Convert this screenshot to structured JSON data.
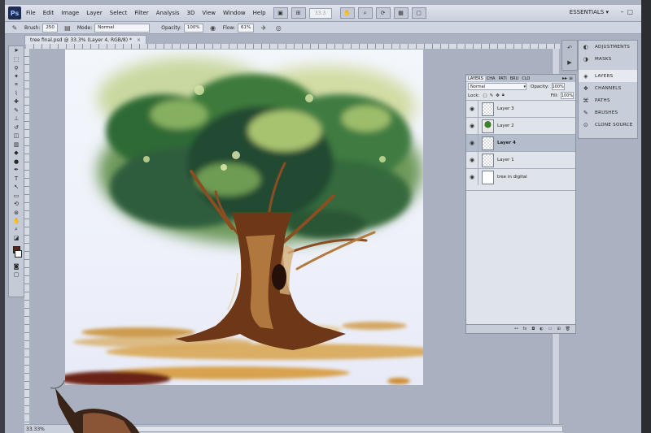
{
  "app": {
    "logo": "Ps",
    "menu": [
      "File",
      "Edit",
      "Image",
      "Layer",
      "Select",
      "Filter",
      "Analysis",
      "3D",
      "View",
      "Window",
      "Help"
    ],
    "zoom_field": "33.3",
    "workspace": "ESSENTIALS",
    "workspace_arrow": "▾"
  },
  "options_bar": {
    "brush_label": "Brush:",
    "brush_size": "250",
    "mode_label": "Mode:",
    "mode_value": "Normal",
    "opacity_label": "Opacity:",
    "opacity_value": "100%",
    "flow_label": "Flow:",
    "flow_value": "61%"
  },
  "document": {
    "tab_title": "tree final.psd @ 33.3% (Layer 4, RGB/8) *",
    "status_zoom": "33.33%"
  },
  "dock": {
    "items": [
      {
        "label": "ADJUSTMENTS",
        "icon": "adjustments-icon"
      },
      {
        "label": "MASKS",
        "icon": "masks-icon"
      },
      {
        "label": "LAYERS",
        "icon": "layers-icon"
      },
      {
        "label": "CHANNELS",
        "icon": "channels-icon"
      },
      {
        "label": "PATHS",
        "icon": "paths-icon"
      },
      {
        "label": "BRUSHES",
        "icon": "brushes-icon"
      },
      {
        "label": "CLONE SOURCE",
        "icon": "clone-source-icon"
      }
    ]
  },
  "layers_panel": {
    "tabs": [
      "LAYERS",
      "CHA",
      "PATI",
      "BRU",
      "CLO"
    ],
    "blend_mode": "Normal",
    "opacity_label": "Opacity:",
    "opacity_value": "100%",
    "lock_label": "Lock:",
    "fill_label": "Fill:",
    "fill_value": "100%",
    "layers": [
      {
        "name": "Layer 3",
        "thumb": "transparent",
        "selected": false
      },
      {
        "name": "Layer 2",
        "thumb": "tree",
        "selected": false
      },
      {
        "name": "Layer 4",
        "thumb": "transparent",
        "selected": true
      },
      {
        "name": "Layer 1",
        "thumb": "transparent",
        "selected": false
      },
      {
        "name": "tree in digital",
        "thumb": "white",
        "selected": false
      }
    ]
  },
  "colors": {
    "foreground": "#5a2416",
    "background": "#ffffff",
    "ui_panel": "#c8ced9",
    "selected_layer": "#b4bdcc"
  }
}
